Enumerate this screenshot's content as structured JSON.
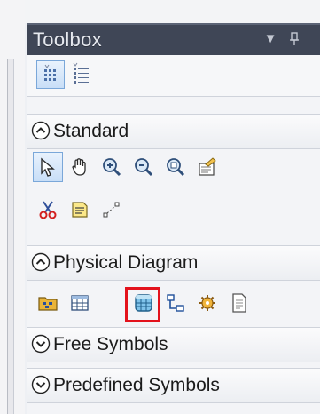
{
  "toolbox": {
    "title": "Toolbox",
    "dropdown_glyph": "▼",
    "pin_glyph": "ᵖ"
  },
  "view_modes": {
    "icons_view": "grid-view-icon",
    "list_view": "list-view-icon"
  },
  "categories": [
    {
      "label": "Standard",
      "expanded": true
    },
    {
      "label": "Physical Diagram",
      "expanded": true
    },
    {
      "label": "Free Symbols",
      "expanded": false
    },
    {
      "label": "Predefined Symbols",
      "expanded": false
    }
  ],
  "standard_tools": [
    "pointer-icon",
    "grabber-hand-icon",
    "zoom-in-icon",
    "zoom-out-icon",
    "open-package-icon",
    "properties-icon",
    "cut-icon",
    "note-icon",
    "link-icon"
  ],
  "physical_tools": [
    "package-icon",
    "table-icon",
    "view-icon",
    "reference-icon",
    "procedure-icon",
    "file-icon"
  ],
  "colors": {
    "titlebar_bg": "#3f4656",
    "selected_bg": "#c8def7",
    "highlight": "#e3121c"
  }
}
